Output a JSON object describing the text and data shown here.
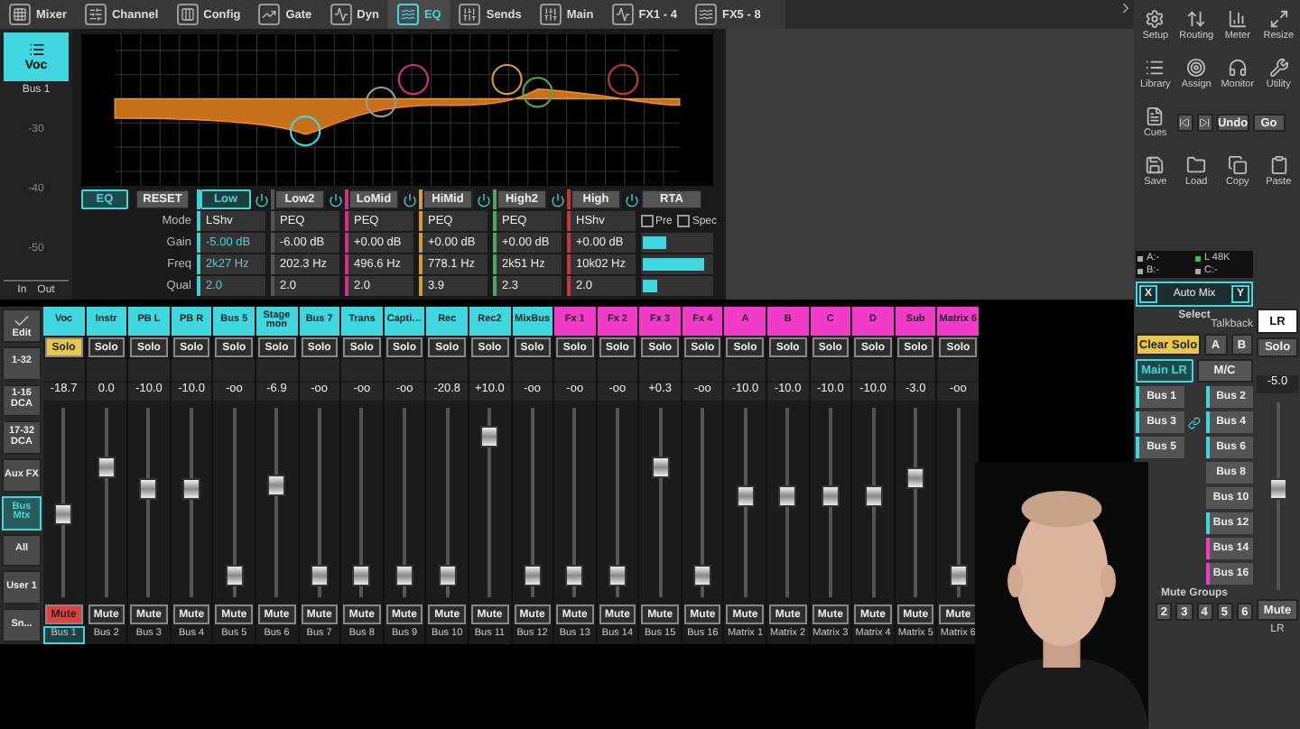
{
  "tabs": [
    {
      "label": "Mixer",
      "selected": false
    },
    {
      "label": "Channel",
      "selected": false
    },
    {
      "label": "Config",
      "selected": false
    },
    {
      "label": "Gate",
      "selected": false
    },
    {
      "label": "Dyn",
      "selected": false
    },
    {
      "label": "EQ",
      "selected": true
    },
    {
      "label": "Sends",
      "selected": false
    },
    {
      "label": "Main",
      "selected": false
    },
    {
      "label": "FX1 - 4",
      "selected": false
    },
    {
      "label": "FX5 - 8",
      "selected": false
    }
  ],
  "current": {
    "name": "Voc",
    "bus": "Bus 1",
    "scale": [
      "-30",
      "-40",
      "-50"
    ],
    "meters": [
      "In",
      "Out"
    ]
  },
  "eq": {
    "on": true,
    "label": "EQ",
    "reset": "RESET",
    "row_labels": [
      "Mode",
      "Gain",
      "Freq",
      "Qual"
    ],
    "bands": [
      {
        "name": "Low",
        "selected": true,
        "color": "#3fd0d0",
        "mode": "LShv",
        "gain": "-5.00 dB",
        "freq": "2k27 Hz",
        "qual": "2.0"
      },
      {
        "name": "Low2",
        "selected": false,
        "color": "#555555",
        "mode": "PEQ",
        "gain": "-6.00 dB",
        "freq": "202.3 Hz",
        "qual": "2.0"
      },
      {
        "name": "LoMid",
        "selected": false,
        "color": "#d0308a",
        "mode": "PEQ",
        "gain": "+0.00 dB",
        "freq": "496.6 Hz",
        "qual": "2.0"
      },
      {
        "name": "HiMid",
        "selected": false,
        "color": "#d89a3a",
        "mode": "PEQ",
        "gain": "+0.00 dB",
        "freq": "778.1 Hz",
        "qual": "3.9"
      },
      {
        "name": "High2",
        "selected": false,
        "color": "#4ca860",
        "mode": "PEQ",
        "gain": "+0.00 dB",
        "freq": "2k51 Hz",
        "qual": "2.3"
      },
      {
        "name": "High",
        "selected": false,
        "color": "#c03a3a",
        "mode": "HShv",
        "gain": "+0.00 dB",
        "freq": "10k02 Hz",
        "qual": "2.0"
      }
    ],
    "rta": "RTA",
    "options": [
      {
        "label": "Pre",
        "checked": false
      },
      {
        "label": "Spec",
        "checked": false
      }
    ],
    "rta_meters": [
      {
        "level": 0.35
      },
      {
        "level": 0.9
      },
      {
        "level": 0.2
      }
    ]
  },
  "strip_nav": [
    {
      "kind": "check",
      "label": "Edit",
      "selected": false
    },
    {
      "kind": "text",
      "label": "1-32",
      "selected": false
    },
    {
      "kind": "text",
      "label": "1-16 DCA",
      "selected": false
    },
    {
      "kind": "text",
      "label": "17-32 DCA",
      "selected": false
    },
    {
      "kind": "text",
      "label": "Aux FX",
      "selected": false
    },
    {
      "kind": "text",
      "label": "Bus Mtx",
      "selected": true
    },
    {
      "kind": "text",
      "label": "All",
      "selected": false
    },
    {
      "kind": "text",
      "label": "User 1",
      "selected": false
    },
    {
      "kind": "text",
      "label": "Sn...",
      "selected": false
    }
  ],
  "channels": [
    {
      "name": "Voc",
      "color": "#3fd8e0",
      "selected": true,
      "solo": {
        "label": "Solo",
        "on": true
      },
      "value": "-18.7",
      "level": 0.45,
      "mute": {
        "label": "Mute",
        "on": true
      },
      "bus": "Bus 1"
    },
    {
      "name": "Instr",
      "color": "#3fd8e0",
      "selected": false,
      "solo": {
        "label": "Solo",
        "on": false
      },
      "value": "0.0",
      "level": 0.72,
      "mute": {
        "label": "Mute",
        "on": false
      },
      "bus": "Bus 2"
    },
    {
      "name": "PB L",
      "color": "#3fd8e0",
      "selected": false,
      "solo": {
        "label": "Solo",
        "on": false
      },
      "value": "-10.0",
      "level": 0.6,
      "mute": {
        "label": "Mute",
        "on": false
      },
      "bus": "Bus 3"
    },
    {
      "name": "PB R",
      "color": "#3fd8e0",
      "selected": false,
      "solo": {
        "label": "Solo",
        "on": false
      },
      "value": "-10.0",
      "level": 0.6,
      "mute": {
        "label": "Mute",
        "on": false
      },
      "bus": "Bus 4"
    },
    {
      "name": "Bus 5",
      "color": "#3fd8e0",
      "selected": false,
      "solo": {
        "label": "Solo",
        "on": false
      },
      "value": "-oo",
      "level": 0.1,
      "mute": {
        "label": "Mute",
        "on": false
      },
      "bus": "Bus 5"
    },
    {
      "name": "Stage mon",
      "color": "#3fd8e0",
      "selected": false,
      "solo": {
        "label": "Solo",
        "on": false
      },
      "value": "-6.9",
      "level": 0.62,
      "mute": {
        "label": "Mute",
        "on": false
      },
      "bus": "Bus 6"
    },
    {
      "name": "Bus 7",
      "color": "#3fd8e0",
      "selected": false,
      "solo": {
        "label": "Solo",
        "on": false
      },
      "value": "-oo",
      "level": 0.1,
      "mute": {
        "label": "Mute",
        "on": false
      },
      "bus": "Bus 7"
    },
    {
      "name": "Trans",
      "color": "#3fd8e0",
      "selected": false,
      "solo": {
        "label": "Solo",
        "on": false
      },
      "value": "-oo",
      "level": 0.1,
      "mute": {
        "label": "Mute",
        "on": false
      },
      "bus": "Bus 8"
    },
    {
      "name": "Capti…",
      "color": "#3fd8e0",
      "selected": false,
      "solo": {
        "label": "Solo",
        "on": false
      },
      "value": "-oo",
      "level": 0.1,
      "mute": {
        "label": "Mute",
        "on": false
      },
      "bus": "Bus 9"
    },
    {
      "name": "Rec",
      "color": "#3fd8e0",
      "selected": false,
      "solo": {
        "label": "Solo",
        "on": false
      },
      "value": "-20.8",
      "level": 0.1,
      "mute": {
        "label": "Mute",
        "on": false
      },
      "bus": "Bus 10"
    },
    {
      "name": "Rec2",
      "color": "#3fd8e0",
      "selected": false,
      "solo": {
        "label": "Solo",
        "on": false
      },
      "value": "+10.0",
      "level": 0.9,
      "mute": {
        "label": "Mute",
        "on": false
      },
      "bus": "Bus 11"
    },
    {
      "name": "MixBus",
      "color": "#3fd8e0",
      "selected": false,
      "solo": {
        "label": "Solo",
        "on": false
      },
      "value": "-oo",
      "level": 0.1,
      "mute": {
        "label": "Mute",
        "on": false
      },
      "bus": "Bus 12"
    },
    {
      "name": "Fx 1",
      "color": "#f03cc8",
      "selected": false,
      "solo": {
        "label": "Solo",
        "on": false
      },
      "value": "-oo",
      "level": 0.1,
      "mute": {
        "label": "Mute",
        "on": false
      },
      "bus": "Bus 13"
    },
    {
      "name": "Fx 2",
      "color": "#f03cc8",
      "selected": false,
      "solo": {
        "label": "Solo",
        "on": false
      },
      "value": "-oo",
      "level": 0.1,
      "mute": {
        "label": "Mute",
        "on": false
      },
      "bus": "Bus 14"
    },
    {
      "name": "Fx 3",
      "color": "#f03cc8",
      "selected": false,
      "solo": {
        "label": "Solo",
        "on": false
      },
      "value": "+0.3",
      "level": 0.72,
      "mute": {
        "label": "Mute",
        "on": false
      },
      "bus": "Bus 15"
    },
    {
      "name": "Fx 4",
      "color": "#f03cc8",
      "selected": false,
      "solo": {
        "label": "Solo",
        "on": false
      },
      "value": "-oo",
      "level": 0.1,
      "mute": {
        "label": "Mute",
        "on": false
      },
      "bus": "Bus 16"
    },
    {
      "name": "A",
      "color": "#f03cc8",
      "selected": false,
      "solo": {
        "label": "Solo",
        "on": false
      },
      "value": "-10.0",
      "level": 0.55,
      "mute": {
        "label": "Mute",
        "on": false
      },
      "bus": "Matrix 1"
    },
    {
      "name": "B",
      "color": "#f03cc8",
      "selected": false,
      "solo": {
        "label": "Solo",
        "on": false
      },
      "value": "-10.0",
      "level": 0.55,
      "mute": {
        "label": "Mute",
        "on": false
      },
      "bus": "Matrix 2"
    },
    {
      "name": "C",
      "color": "#f03cc8",
      "selected": false,
      "solo": {
        "label": "Solo",
        "on": false
      },
      "value": "-10.0",
      "level": 0.55,
      "mute": {
        "label": "Mute",
        "on": false
      },
      "bus": "Matrix 3"
    },
    {
      "name": "D",
      "color": "#f03cc8",
      "selected": false,
      "solo": {
        "label": "Solo",
        "on": false
      },
      "value": "-10.0",
      "level": 0.55,
      "mute": {
        "label": "Mute",
        "on": false
      },
      "bus": "Matrix 4"
    },
    {
      "name": "Sub",
      "color": "#f03cc8",
      "selected": false,
      "solo": {
        "label": "Solo",
        "on": false
      },
      "value": "-3.0",
      "level": 0.66,
      "mute": {
        "label": "Mute",
        "on": false
      },
      "bus": "Matrix 5"
    },
    {
      "name": "Matrix 6",
      "color": "#f03cc8",
      "selected": false,
      "solo": {
        "label": "Solo",
        "on": false
      },
      "value": "-oo",
      "level": 0.1,
      "mute": {
        "label": "Mute",
        "on": false
      },
      "bus": "Matrix 6"
    }
  ],
  "tools": [
    "Setup",
    "Routing",
    "Meter",
    "Resize",
    "Library",
    "Assign",
    "Monitor",
    "Utility",
    "Cues"
  ],
  "transport": [
    "Undo",
    "Go"
  ],
  "files": [
    "Save",
    "Load",
    "Copy",
    "Paste"
  ],
  "status": [
    {
      "label": "A:-",
      "on": false
    },
    {
      "label": "L  48K",
      "on": true
    },
    {
      "label": "B:-",
      "on": false
    },
    {
      "label": "C:-",
      "on": false
    }
  ],
  "automix": {
    "label": "Auto Mix",
    "x": "X",
    "y": "Y"
  },
  "select": {
    "title": "Select",
    "talkback": "Talkback",
    "clear_solo": "Clear Solo",
    "talkback_buttons": [
      "A",
      "B"
    ],
    "main": [
      {
        "label": "Main LR",
        "selected": true
      },
      {
        "label": "M/C",
        "selected": false
      }
    ],
    "rows": [
      {
        "left": {
          "label": "Bus 1",
          "color": "#3fd8e0"
        },
        "right": {
          "label": "Bus 2",
          "color": "#3fd8e0"
        },
        "linked": false
      },
      {
        "left": {
          "label": "Bus 3",
          "color": "#3fd8e0"
        },
        "right": {
          "label": "Bus 4",
          "color": "#3fd8e0"
        },
        "linked": true
      },
      {
        "left": {
          "label": "Bus 5",
          "color": "#3fd8e0"
        },
        "right": {
          "label": "Bus 6",
          "color": "#3fd8e0"
        },
        "linked": false
      },
      {
        "right": {
          "label": "Bus 8"
        },
        "linked": false
      },
      {
        "right": {
          "label": "Bus 10"
        },
        "linked": false
      },
      {
        "right": {
          "label": "Bus 12",
          "color": "#3fd8e0"
        },
        "linked": false
      },
      {
        "right": {
          "label": "Bus 14",
          "color": "#f03cc8"
        },
        "linked": false
      },
      {
        "right": {
          "label": "Bus 16",
          "color": "#f03cc8"
        },
        "linked": false
      }
    ],
    "mute_groups_title": "Mute Groups",
    "mute_groups": [
      "2",
      "3",
      "4",
      "5",
      "6"
    ]
  },
  "master": {
    "name": "LR",
    "solo": "Solo",
    "value": "-5.0",
    "level": 0.55,
    "mute": "Mute",
    "label": "LR"
  },
  "overlay": {
    "kind": "picture"
  }
}
